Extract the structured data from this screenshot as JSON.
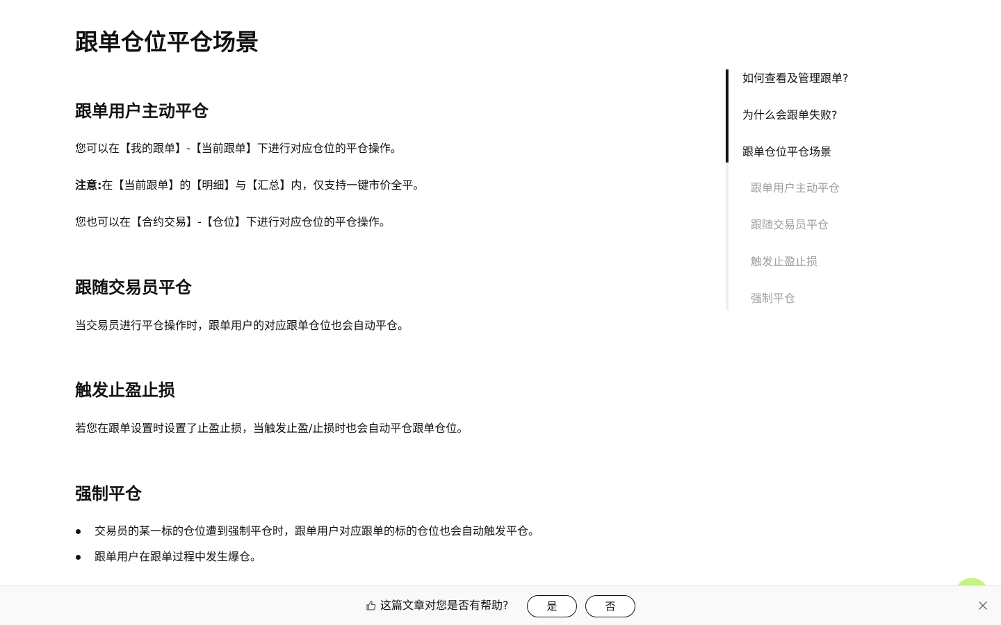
{
  "article": {
    "title": "跟单仓位平仓场景",
    "sections": [
      {
        "heading": "跟单用户主动平仓",
        "paragraphs": [
          "您可以在【我的跟单】-【当前跟单】下进行对应仓位的平仓操作。",
          "您也可以在【合约交易】-【仓位】下进行对应仓位的平仓操作。"
        ],
        "note_label": "注意:",
        "note_text": "在【当前跟单】的【明细】与【汇总】内，仅支持一键市价全平。"
      },
      {
        "heading": "跟随交易员平仓",
        "paragraphs": [
          "当交易员进行平仓操作时，跟单用户的对应跟单仓位也会自动平仓。"
        ]
      },
      {
        "heading": "触发止盈止损",
        "paragraphs": [
          "若您在跟单设置时设置了止盈止损，当触发止盈/止损时也会自动平仓跟单仓位。"
        ]
      },
      {
        "heading": "强制平仓",
        "bullets": [
          "交易员的某一标的仓位遭到强制平仓时，跟单用户对应跟单的标的仓位也会自动触发平仓。",
          "跟单用户在跟单过程中发生爆仓。"
        ]
      }
    ]
  },
  "toc": {
    "items": [
      {
        "label": "如何查看及管理跟单?",
        "level": 1
      },
      {
        "label": "为什么会跟单失败?",
        "level": 1
      },
      {
        "label": "跟单仓位平仓场景",
        "level": 1,
        "active": true
      },
      {
        "label": "跟单用户主动平仓",
        "level": 2
      },
      {
        "label": "跟随交易员平仓",
        "level": 2
      },
      {
        "label": "触发止盈止损",
        "level": 2
      },
      {
        "label": "强制平仓",
        "level": 2
      }
    ],
    "active_color": "#121212",
    "inactive_color": "#9e9e9e"
  },
  "feedback": {
    "question": "这篇文章对您是否有帮助?",
    "yes_label": "是",
    "no_label": "否",
    "icon": "thumbs-up-icon",
    "close_icon": "close-icon"
  },
  "colors": {
    "accent": "#c7f284",
    "text": "#121212",
    "muted": "#9e9e9e"
  }
}
